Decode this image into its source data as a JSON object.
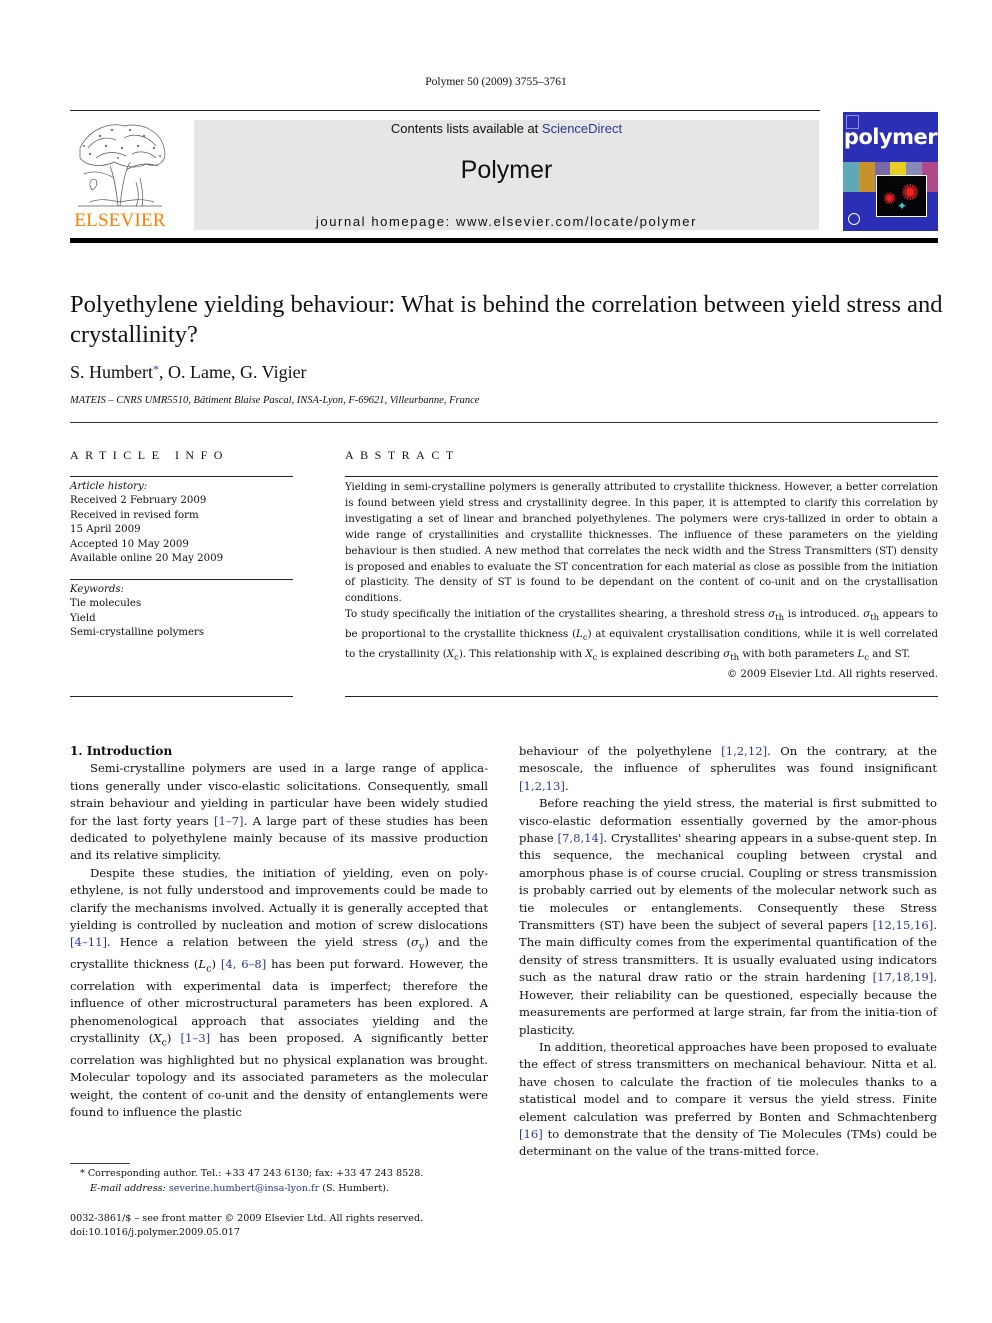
{
  "citation": "Polymer 50 (2009) 3755–3761",
  "header": {
    "contents_prefix": "Contents lists available at ",
    "contents_link": "ScienceDirect",
    "journal_name": "Polymer",
    "homepage": "journal homepage: www.elsevier.com/locate/polymer",
    "publisher_logo_text": "ELSEVIER",
    "cover_title": "polymer"
  },
  "colors": {
    "link": "#2b3990",
    "elsevier_orange": "#ff7f00",
    "header_box": "#e6e6e6",
    "cover_blue": "#2a2fb6"
  },
  "article": {
    "title": "Polyethylene yielding behaviour: What is behind the correlation between yield stress and crystallinity?",
    "authors": {
      "first": "S. Humbert",
      "star": "*",
      "rest": ", O. Lame, G. Vigier"
    },
    "affiliation": "MATEIS – CNRS UMR5510, Bâtiment Blaise Pascal, INSA-Lyon, F-69621, Villeurbanne, France"
  },
  "article_info": {
    "heading": "ARTICLE INFO",
    "history_label": "Article history:",
    "history": [
      "Received 2 February 2009",
      "Received in revised form",
      "15 April 2009",
      "Accepted 10 May 2009",
      "Available online 20 May 2009"
    ],
    "keywords_label": "Keywords:",
    "keywords": [
      "Tie molecules",
      "Yield",
      "Semi-crystalline polymers"
    ]
  },
  "abstract": {
    "heading": "ABSTRACT",
    "p1": "Yielding in semi-crystalline polymers is generally attributed to crystallite thickness. However, a better correlation is found between yield stress and crystallinity degree. In this paper, it is attempted to clarify this correlation by investigating a set of linear and branched polyethylenes. The polymers were crys-tallized in order to obtain a wide range of crystallinities and crystallite thicknesses. The influence of these parameters on the yielding behaviour is then studied. A new method that correlates the neck width and the Stress Transmitters (ST) density is proposed and enables to evaluate the ST concentration for each material as close as possible from the initiation of plasticity. The density of ST is found to be dependant on the content of co-unit and on the crystallisation conditions.",
    "p2": {
      "a": "To study specifically the initiation of the crystallites shearing, a threshold stress ",
      "sym": "σ",
      "sub_th": "th",
      "b": " is introduced. ",
      "c": " appears to be proportional to the crystallite thickness (",
      "L": "L",
      "sub_c": "c",
      "d": ") at equivalent crystallisation conditions, while it is well correlated to the crystallinity (",
      "X": "X",
      "e": "). This relationship with ",
      "f": " is explained describing ",
      "g": " with both parameters ",
      "h": " and ST."
    },
    "copyright": "© 2009 Elsevier Ltd. All rights reserved."
  },
  "body": {
    "section_heading": "1.  Introduction",
    "left": {
      "p1_a": "Semi-crystalline polymers are used in a large range of applica-tions generally under visco-elastic solicitations. Consequently, small strain behaviour and yielding in particular have been widely studied for the last forty years ",
      "p1_ref1": "[1–7]",
      "p1_b": ". A large part of these studies has been dedicated to polyethylene mainly because of its massive production and its relative simplicity.",
      "p2_a": "Despite these studies, the initiation of yielding, even on poly-ethylene, is not fully understood and improvements could be made to clarify the mechanisms involved. Actually it is generally accepted that yielding is controlled by nucleation and motion of screw dislocations ",
      "p2_ref1": "[4–11]",
      "p2_b": ". Hence a relation between the yield stress (",
      "sigma": "σ",
      "sub_y": "y",
      "p2_c": ") and the crystallite thickness (",
      "L": "L",
      "sub_c": "c",
      "p2_d": ") ",
      "p2_ref2": "[4, 6–8]",
      "p2_e": " has been put forward. However, the correlation with experimental data is imperfect; therefore the influence of other microstructural parameters has been explored. A phenomenological approach that associates yielding and the crystallinity (",
      "X": "X",
      "p2_f": ") ",
      "p2_ref3": "[1–3]",
      "p2_g": " has been proposed. A significantly better correlation was highlighted but no physical explanation was brought. Molecular topology and its associated parameters as the molecular weight, the content of co-unit and the density of entanglements were found to influence the plastic"
    },
    "right": {
      "p1_a": "behaviour of the polyethylene ",
      "p1_ref1": "[1,2,12]",
      "p1_b": ". On the contrary, at the mesoscale, the influence of spherulites was found insignificant ",
      "p1_ref2": "[1,2,13]",
      "p1_c": ".",
      "p2_a": "Before reaching the yield stress, the material is first submitted to visco-elastic deformation essentially governed by the amor-phous phase ",
      "p2_ref1": "[7,8,14]",
      "p2_b": ". Crystallites' shearing appears in a subse-quent step. In this sequence, the mechanical coupling between crystal and amorphous phase is of course crucial. Coupling or stress transmission is probably carried out by elements of the molecular network such as tie molecules or entanglements. Consequently these Stress Transmitters (ST) have been the subject of several papers ",
      "p2_ref2": "[12,15,16]",
      "p2_c": ". The main difficulty comes from the experimental quantification of the density of stress transmitters. It is usually evaluated using indicators such as the natural draw ratio or the strain hardening ",
      "p2_ref3": "[17,18,19]",
      "p2_d": ". However, their reliability can be questioned, especially because the measurements are performed at large strain, far from the initia-tion of plasticity.",
      "p3_a": "In addition, theoretical approaches have been proposed to evaluate the effect of stress transmitters on mechanical behaviour. Nitta et al. have chosen to calculate the fraction of tie molecules thanks to a statistical model and to compare it versus the yield stress. Finite element calculation was preferred by Bonten and Schmachtenberg ",
      "p3_ref1": "[16]",
      "p3_b": " to demonstrate that the density of Tie Molecules (TMs) could be determinant on the value of the trans-mitted force."
    }
  },
  "footnote": {
    "star": "*",
    "corresponding": " Corresponding author. Tel.: +33 47 243 6130; fax: +33 47 243 8528.",
    "email_label": "E-mail address:",
    "email": "severine.humbert@insa-lyon.fr",
    "email_suffix": " (S. Humbert)."
  },
  "front_matter": {
    "issn_line": "0032-3861/$ – see front matter © 2009 Elsevier Ltd. All rights reserved.",
    "doi": "doi:10.1016/j.polymer.2009.05.017"
  }
}
